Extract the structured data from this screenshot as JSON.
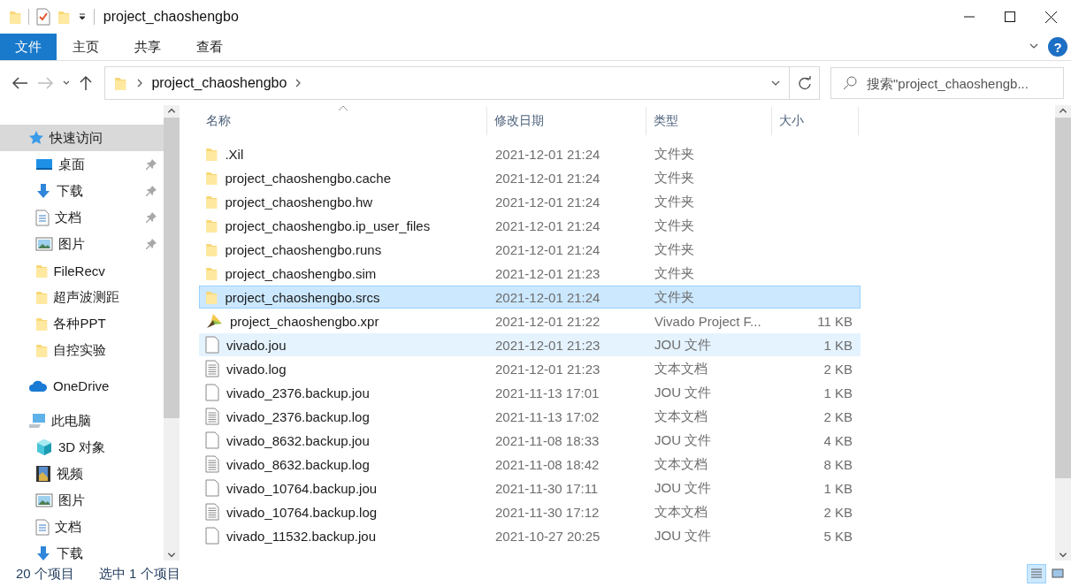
{
  "window": {
    "title": "project_chaoshengbo"
  },
  "ribbon": {
    "tabs": [
      {
        "label": "文件",
        "kind": "file"
      },
      {
        "label": "主页",
        "kind": "tab"
      },
      {
        "label": "共享",
        "kind": "tab"
      },
      {
        "label": "查看",
        "kind": "tab"
      }
    ],
    "help": "?"
  },
  "address": {
    "path": [
      "project_chaoshengbo"
    ],
    "search": {
      "placeholder": "搜索\"project_chaoshengb..."
    }
  },
  "sidebar": {
    "items": [
      {
        "label": "快速访问",
        "kind": "star",
        "selected": true,
        "children": [
          {
            "label": "桌面",
            "kind": "desktop",
            "pinned": true
          },
          {
            "label": "下载",
            "kind": "download",
            "pinned": true
          },
          {
            "label": "文档",
            "kind": "document",
            "pinned": true
          },
          {
            "label": "图片",
            "kind": "pictures",
            "pinned": true
          },
          {
            "label": "FileRecv",
            "kind": "folder",
            "pinned": false
          },
          {
            "label": "超声波测距",
            "kind": "folder",
            "pinned": false
          },
          {
            "label": "各种PPT",
            "kind": "folder",
            "pinned": false
          },
          {
            "label": "自控实验",
            "kind": "folder",
            "pinned": false
          }
        ]
      },
      {
        "label": "OneDrive",
        "kind": "cloud",
        "selected": false
      },
      {
        "label": "此电脑",
        "kind": "pc",
        "selected": false,
        "children": [
          {
            "label": "3D 对象",
            "kind": "cube",
            "pinned": false
          },
          {
            "label": "视频",
            "kind": "video",
            "pinned": false
          },
          {
            "label": "图片",
            "kind": "pictures",
            "pinned": false
          },
          {
            "label": "文档",
            "kind": "document",
            "pinned": false
          },
          {
            "label": "下载",
            "kind": "download",
            "pinned": false
          }
        ]
      }
    ]
  },
  "table": {
    "columns": [
      "名称",
      "修改日期",
      "类型",
      "大小"
    ],
    "rows": [
      {
        "kind": "folder",
        "name": ".Xil",
        "date": "2021-12-01 21:24",
        "type": "文件夹",
        "selected": false,
        "hovered": false
      },
      {
        "kind": "folder",
        "name": "project_chaoshengbo.cache",
        "date": "2021-12-01 21:24",
        "type": "文件夹",
        "selected": false,
        "hovered": false
      },
      {
        "kind": "folder",
        "name": "project_chaoshengbo.hw",
        "date": "2021-12-01 21:24",
        "type": "文件夹",
        "selected": false,
        "hovered": false
      },
      {
        "kind": "folder",
        "name": "project_chaoshengbo.ip_user_files",
        "date": "2021-12-01 21:24",
        "type": "文件夹",
        "selected": false,
        "hovered": false
      },
      {
        "kind": "folder",
        "name": "project_chaoshengbo.runs",
        "date": "2021-12-01 21:24",
        "type": "文件夹",
        "selected": false,
        "hovered": false
      },
      {
        "kind": "folder",
        "name": "project_chaoshengbo.sim",
        "date": "2021-12-01 21:23",
        "type": "文件夹",
        "selected": false,
        "hovered": false
      },
      {
        "kind": "folder",
        "name": "project_chaoshengbo.srcs",
        "date": "2021-12-01 21:24",
        "type": "文件夹",
        "selected": true,
        "hovered": false
      },
      {
        "kind": "project",
        "name": "project_chaoshengbo.xpr",
        "date": "2021-12-01 21:22",
        "type": "Vivado Project F...",
        "size": "11 KB",
        "selected": false,
        "hovered": false
      },
      {
        "kind": "blank",
        "name": "vivado.jou",
        "date": "2021-12-01 21:23",
        "type": "JOU 文件",
        "size": "1 KB",
        "selected": false,
        "hovered": true
      },
      {
        "kind": "text",
        "name": "vivado.log",
        "date": "2021-12-01 21:23",
        "type": "文本文档",
        "size": "2 KB",
        "selected": false,
        "hovered": false
      },
      {
        "kind": "blank",
        "name": "vivado_2376.backup.jou",
        "date": "2021-11-13 17:01",
        "type": "JOU 文件",
        "size": "1 KB",
        "selected": false,
        "hovered": false
      },
      {
        "kind": "text",
        "name": "vivado_2376.backup.log",
        "date": "2021-11-13 17:02",
        "type": "文本文档",
        "size": "2 KB",
        "selected": false,
        "hovered": false
      },
      {
        "kind": "blank",
        "name": "vivado_8632.backup.jou",
        "date": "2021-11-08 18:33",
        "type": "JOU 文件",
        "size": "4 KB",
        "selected": false,
        "hovered": false
      },
      {
        "kind": "text",
        "name": "vivado_8632.backup.log",
        "date": "2021-11-08 18:42",
        "type": "文本文档",
        "size": "8 KB",
        "selected": false,
        "hovered": false
      },
      {
        "kind": "blank",
        "name": "vivado_10764.backup.jou",
        "date": "2021-11-30 17:11",
        "type": "JOU 文件",
        "size": "1 KB",
        "selected": false,
        "hovered": false
      },
      {
        "kind": "text",
        "name": "vivado_10764.backup.log",
        "date": "2021-11-30 17:12",
        "type": "文本文档",
        "size": "2 KB",
        "selected": false,
        "hovered": false
      },
      {
        "kind": "blank",
        "name": "vivado_11532.backup.jou",
        "date": "2021-10-27 20:25",
        "type": "JOU 文件",
        "size": "5 KB",
        "selected": false,
        "hovered": false
      }
    ]
  },
  "status_bar": {
    "count": "20 个项目",
    "selection": "选中 1 个项目",
    "views": [
      {
        "kind": "details",
        "selected": true
      },
      {
        "kind": "icons",
        "selected": false
      }
    ]
  }
}
